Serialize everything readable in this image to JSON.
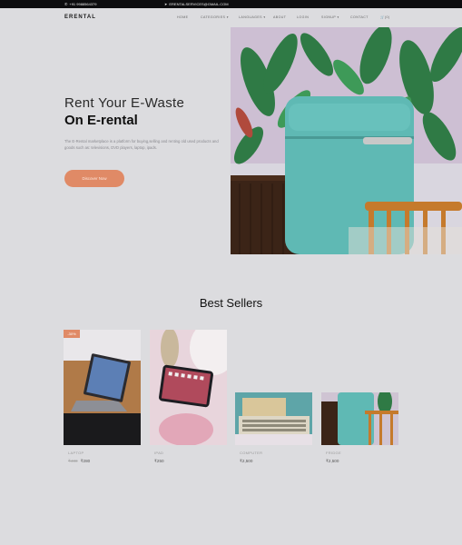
{
  "topbar": {
    "phone": "+91 9988564379",
    "email": "ERENTALSERVICES@GMAIL.COM"
  },
  "nav": {
    "brand": "ERENTAL",
    "items": [
      "HOME",
      "CATEGORIES ▾",
      "LANGUAGES ▾",
      "ABOUT",
      "LOGIN",
      "SIGNUP ▾",
      "CONTACT",
      "(0)"
    ]
  },
  "hero": {
    "title_line1": "Rent Your E-Waste",
    "title_line2": "On E-rental",
    "description": "The E-Rental marketplace is a platform for buying,selling and renting old used products and goods such as: televisions, DVD players, laptop, ipads.",
    "cta_label": "Discover Now"
  },
  "best_sellers": {
    "title": "Best Sellers",
    "products": [
      {
        "name": "LAPTOP",
        "old_price": "₹400",
        "price": "₹280",
        "badge": "-30%"
      },
      {
        "name": "IPAD",
        "price": "₹250"
      },
      {
        "name": "COMPUTER",
        "price": "₹2,500"
      },
      {
        "name": "FRIDGE",
        "price": "₹2,500"
      }
    ]
  },
  "colors": {
    "accent": "#e08a66",
    "topbar": "#0d0d0f",
    "fridge": "#5fb9b4"
  }
}
